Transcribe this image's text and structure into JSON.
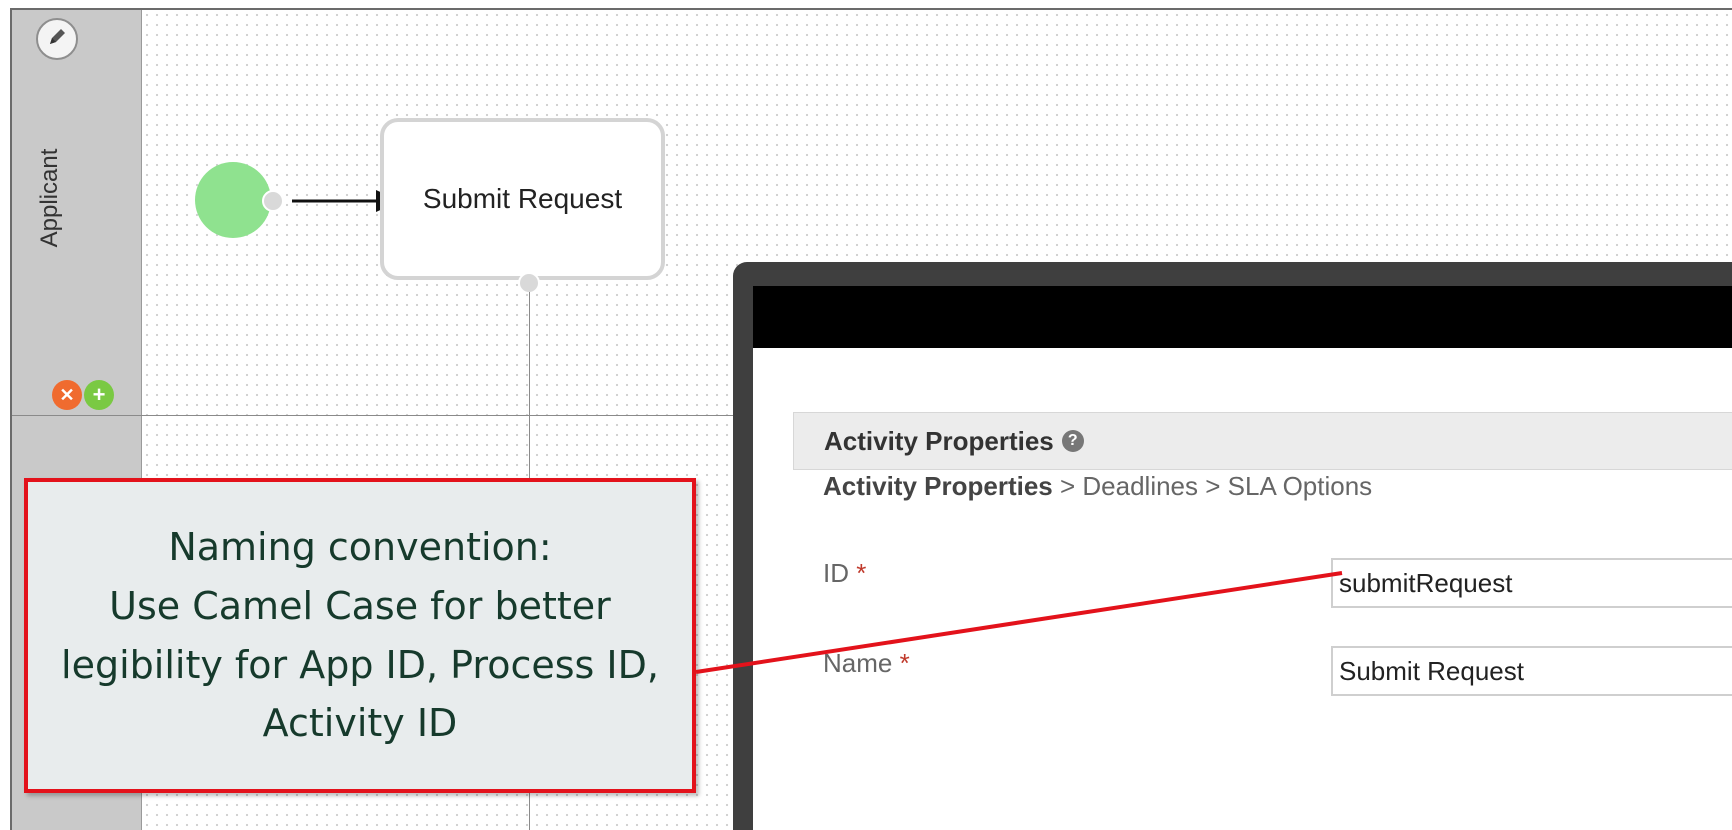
{
  "lane": {
    "label": "Applicant",
    "edit_icon": "pencil-icon",
    "remove_icon": "close-icon",
    "add_icon": "plus-icon",
    "remove_symbol": "✕",
    "add_symbol": "+"
  },
  "process": {
    "activity_label": "Submit Request",
    "start_event_color": "#8fe28f"
  },
  "dialog": {
    "section_title": "Activity Properties",
    "help_icon": "question-circle-icon",
    "help_symbol": "?",
    "breadcrumb": {
      "current": "Activity Properties",
      "rest": " > Deadlines > SLA Options"
    },
    "fields": [
      {
        "label": "ID",
        "required_mark": "*",
        "value": "submitRequest"
      },
      {
        "label": "Name",
        "required_mark": "*",
        "value": "Submit Request"
      }
    ]
  },
  "callout": {
    "text": "Naming convention:\nUse Camel Case for better legibility for App ID, Process ID, Activity ID",
    "border_color": "#e3121b"
  }
}
